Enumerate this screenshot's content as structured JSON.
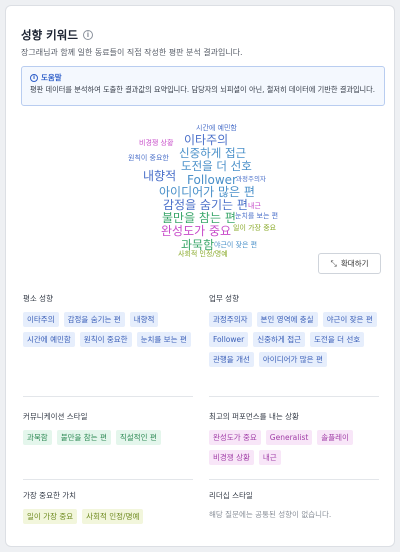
{
  "header": {
    "title": "성향 키워드",
    "subtitle": "장그래님과 함께 일한 동료들이 직접 작성한 평판 분석 결과입니다."
  },
  "help": {
    "heading": "도움말",
    "text": "평판 데이터를 분석하여 도출한 결과값의 요약입니다. 담당자의 뇌피셜이 아닌, 철저히 데이터에 기반한 결과입니다."
  },
  "word_cloud": [
    {
      "text": "시간에 예민함",
      "color": "#4a6fc9"
    },
    {
      "text": "비경쟁 상황",
      "color": "#c74bc9"
    },
    {
      "text": "이타주의",
      "color": "#4a6fc9"
    },
    {
      "text": "원칙이 중요한",
      "color": "#4a6fc9"
    },
    {
      "text": "신중하게 접근",
      "color": "#4a90c9"
    },
    {
      "text": "도전을 더 선호",
      "color": "#4a90c9"
    },
    {
      "text": "내향적",
      "color": "#4a6fc9"
    },
    {
      "text": "Follower",
      "color": "#4a90c9"
    },
    {
      "text": "과정주의자",
      "color": "#4a6fc9"
    },
    {
      "text": "아이디어가 많은 편",
      "color": "#4a90c9"
    },
    {
      "text": "감정을 숨기는 편",
      "color": "#4a6fc9"
    },
    {
      "text": "내근",
      "color": "#c74bc9"
    },
    {
      "text": "불만을 참는 편",
      "color": "#3aa66a"
    },
    {
      "text": "눈치를 보는 편",
      "color": "#4a6fc9"
    },
    {
      "text": "완성도가 중요",
      "color": "#c74bc9"
    },
    {
      "text": "일이 가장 중요",
      "color": "#8aaa2a"
    },
    {
      "text": "과묵함",
      "color": "#3aa66a"
    },
    {
      "text": "야근이 잦은 편",
      "color": "#4a90c9"
    },
    {
      "text": "사회적 인정/명예",
      "color": "#8aaa2a"
    },
    {
      "text": "Generalist",
      "color": "#c74bc9"
    },
    {
      "text": "솔플레이",
      "color": "#c74bc9"
    },
    {
      "text": "관행을 개선",
      "color": "#4a90c9"
    },
    {
      "text": "본인 영역에 충실",
      "color": "#4a90c9"
    },
    {
      "text": "직설적인 편",
      "color": "#3aa66a"
    }
  ],
  "expand_button": {
    "label": "확대하기"
  },
  "sections": {
    "usual": {
      "title": "평소 성향",
      "tags": [
        "이타주의",
        "감정을 숨기는 편",
        "내향적",
        "시간에 예민함",
        "원칙이 중요한",
        "눈치를 보는 편"
      ]
    },
    "work": {
      "title": "업무 성향",
      "tags": [
        "과정주의자",
        "본인 영역에 충실",
        "야근이 잦은 편",
        "Follower",
        "신중하게 접근",
        "도전을 더 선호",
        "관행을 개선",
        "아이디어가 많은 편"
      ]
    },
    "communication": {
      "title": "커뮤니케이션 스타일",
      "tags": [
        "과묵함",
        "불만을 참는 편",
        "직설적인 편"
      ]
    },
    "best_performance": {
      "title": "최고의 퍼포먼스를 내는 상황",
      "tags": [
        "완성도가 중요",
        "Generalist",
        "솔플레이",
        "비경쟁 상황",
        "내근"
      ]
    },
    "values": {
      "title": "가장 중요한 가치",
      "tags": [
        "일이 가장 중요",
        "사회적 인정/명예"
      ]
    },
    "leadership": {
      "title": "리더십 스타일",
      "empty_text": "해당 질문에는 공통된 성향이 없습니다."
    }
  }
}
